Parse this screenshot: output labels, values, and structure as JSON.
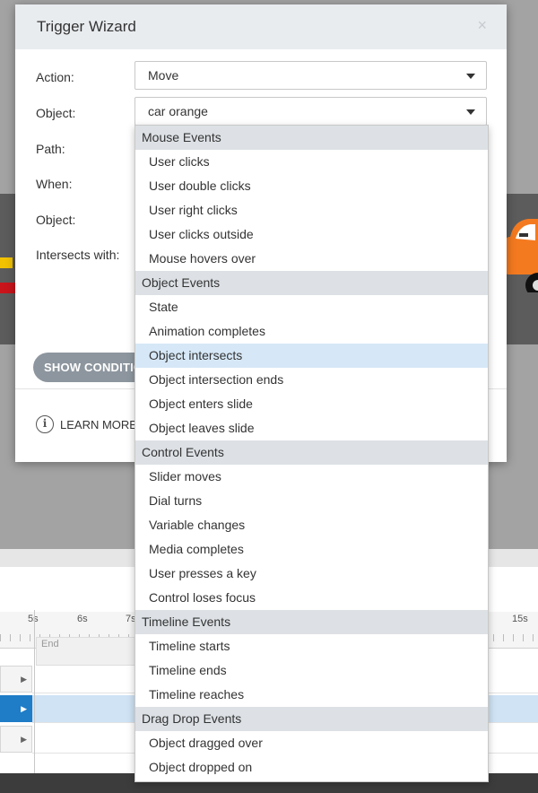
{
  "dialog": {
    "title": "Trigger Wizard",
    "close_glyph": "×",
    "fields": {
      "action_label": "Action:",
      "action_value": "Move",
      "object_label": "Object:",
      "object_value": "car orange",
      "path_label": "Path:",
      "when_label": "When:",
      "object2_label": "Object:",
      "intersects_label": "Intersects with:"
    },
    "show_conditions_label": "SHOW CONDITIONS",
    "learn_more_label": "LEARN MORE"
  },
  "dropdown": {
    "groups": [
      {
        "label": "Mouse Events",
        "items": [
          "User clicks",
          "User double clicks",
          "User right clicks",
          "User clicks outside",
          "Mouse hovers over"
        ]
      },
      {
        "label": "Object Events",
        "items": [
          "State",
          "Animation completes",
          "Object intersects",
          "Object intersection ends",
          "Object enters slide",
          "Object leaves slide"
        ]
      },
      {
        "label": "Control Events",
        "items": [
          "Slider moves",
          "Dial turns",
          "Variable changes",
          "Media completes",
          "User presses a key",
          "Control loses focus"
        ]
      },
      {
        "label": "Timeline Events",
        "items": [
          "Timeline starts",
          "Timeline ends",
          "Timeline reaches"
        ]
      },
      {
        "label": "Drag Drop Events",
        "items": [
          "Object dragged over",
          "Object dropped on"
        ]
      }
    ],
    "highlighted": "Object intersects"
  },
  "timeline": {
    "ruler": [
      "5s",
      "6s",
      "7s",
      "15s"
    ],
    "end_label": "End"
  },
  "colors": {
    "accent": "#1f7cc7",
    "highlight": "#d6e8f7",
    "group_bg": "#dde1e5",
    "car": "#f47a20"
  },
  "icons": [
    "close-icon",
    "dropdown-caret-icon",
    "info-icon",
    "expand-arrow-icon",
    "car-icon"
  ]
}
